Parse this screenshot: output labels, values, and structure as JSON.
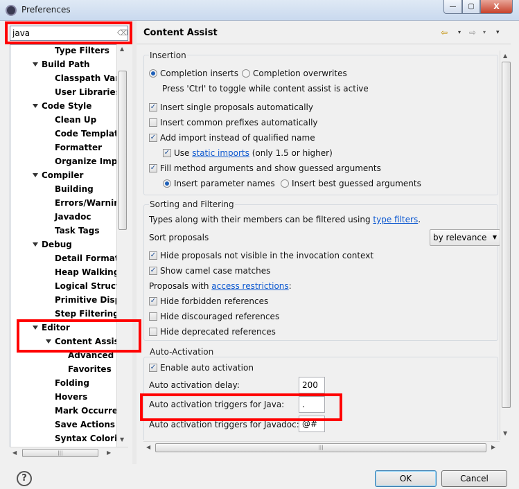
{
  "window": {
    "title": "Preferences",
    "min_glyph": "—",
    "max_glyph": "▢",
    "close_glyph": "X"
  },
  "search": {
    "value": "java"
  },
  "tree": {
    "items": [
      {
        "label": "Type Filters",
        "level": 2,
        "expanded": false
      },
      {
        "label": "Build Path",
        "level": 1,
        "expanded": true
      },
      {
        "label": "Classpath Vari",
        "level": 2,
        "expanded": false
      },
      {
        "label": "User Libraries",
        "level": 2,
        "expanded": false
      },
      {
        "label": "Code Style",
        "level": 1,
        "expanded": true
      },
      {
        "label": "Clean Up",
        "level": 2,
        "expanded": false
      },
      {
        "label": "Code Templat",
        "level": 2,
        "expanded": false
      },
      {
        "label": "Formatter",
        "level": 2,
        "expanded": false
      },
      {
        "label": "Organize Impo",
        "level": 2,
        "expanded": false
      },
      {
        "label": "Compiler",
        "level": 1,
        "expanded": true
      },
      {
        "label": "Building",
        "level": 2,
        "expanded": false
      },
      {
        "label": "Errors/Warnin",
        "level": 2,
        "expanded": false
      },
      {
        "label": "Javadoc",
        "level": 2,
        "expanded": false
      },
      {
        "label": "Task Tags",
        "level": 2,
        "expanded": false
      },
      {
        "label": "Debug",
        "level": 1,
        "expanded": true
      },
      {
        "label": "Detail Formatt",
        "level": 2,
        "expanded": false
      },
      {
        "label": "Heap Walking",
        "level": 2,
        "expanded": false
      },
      {
        "label": "Logical Structu",
        "level": 2,
        "expanded": false
      },
      {
        "label": "Primitive Disp",
        "level": 2,
        "expanded": false
      },
      {
        "label": "Step Filtering",
        "level": 2,
        "expanded": false
      },
      {
        "label": "Editor",
        "level": 1,
        "expanded": true
      },
      {
        "label": "Content Assist",
        "level": 2,
        "expanded": true
      },
      {
        "label": "Advanced",
        "level": 3,
        "expanded": false
      },
      {
        "label": "Favorites",
        "level": 3,
        "expanded": false
      },
      {
        "label": "Folding",
        "level": 2,
        "expanded": false
      },
      {
        "label": "Hovers",
        "level": 2,
        "expanded": false
      },
      {
        "label": "Mark Occurren",
        "level": 2,
        "expanded": false
      },
      {
        "label": "Save Actions",
        "level": 2,
        "expanded": false
      },
      {
        "label": "Syntax Colorin",
        "level": 2,
        "expanded": false
      }
    ]
  },
  "page": {
    "title": "Content Assist"
  },
  "nav": {
    "back": "⇦",
    "forward": "⇨",
    "dropdown": "▾",
    "view_menu": "▾"
  },
  "insertion": {
    "label": "Insertion",
    "completion_inserts": "Completion inserts",
    "completion_overwrites": "Completion overwrites",
    "toggle_hint": "Press 'Ctrl' to toggle while content assist is active",
    "insert_single": "Insert single proposals automatically",
    "insert_common": "Insert common prefixes automatically",
    "add_import": "Add import instead of qualified name",
    "use_prefix": "Use",
    "static_imports": "static imports",
    "use_suffix": "(only 1.5 or higher)",
    "fill_args": "Fill method arguments and show guessed arguments",
    "insert_param_names": "Insert parameter names",
    "insert_best_guessed": "Insert best guessed arguments"
  },
  "sorting": {
    "label": "Sorting and Filtering",
    "types_prefix": "Types along with their members can be filtered using",
    "type_filters_link": "type filters",
    "types_suffix": ".",
    "sort_proposals": "Sort proposals",
    "sort_value": "by relevance",
    "hide_not_visible": "Hide proposals not visible in the invocation context",
    "camel_case": "Show camel case matches",
    "proposals_with": "Proposals with",
    "access_restrictions": "access restrictions",
    "colon": ":",
    "hide_forbidden": "Hide forbidden references",
    "hide_discouraged": "Hide discouraged references",
    "hide_deprecated": "Hide deprecated references"
  },
  "auto": {
    "label": "Auto-Activation",
    "enable": "Enable auto activation",
    "delay_label": "Auto activation delay:",
    "delay_value": "200",
    "java_label": "Auto activation triggers for Java:",
    "java_value": ".",
    "javadoc_label": "Auto activation triggers for Javadoc:",
    "javadoc_value": "@#"
  },
  "checks": {
    "check_mark": "✓"
  },
  "footer": {
    "help": "?",
    "ok": "OK",
    "cancel": "Cancel"
  }
}
